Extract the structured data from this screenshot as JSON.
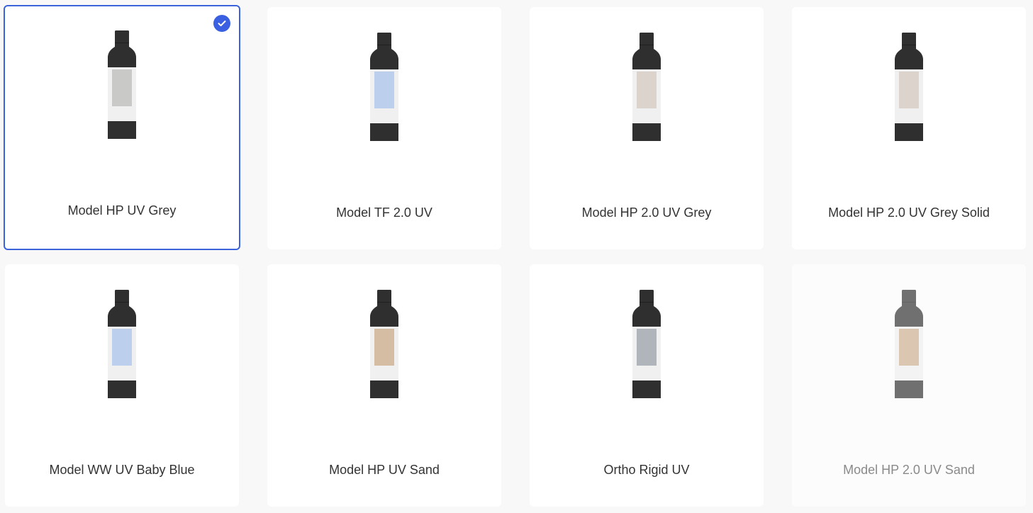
{
  "materials": [
    {
      "name": "Model HP UV Grey",
      "resin_color": "#c9c9c7",
      "selected": true,
      "disabled": false
    },
    {
      "name": "Model TF 2.0 UV",
      "resin_color": "#bccfec",
      "selected": false,
      "disabled": false
    },
    {
      "name": "Model HP 2.0 UV Grey",
      "resin_color": "#dcd3cc",
      "selected": false,
      "disabled": false
    },
    {
      "name": "Model HP 2.0 UV Grey Solid",
      "resin_color": "#dcd3cd",
      "selected": false,
      "disabled": false
    },
    {
      "name": "Model WW UV Baby Blue",
      "resin_color": "#bccfec",
      "selected": false,
      "disabled": false
    },
    {
      "name": "Model HP UV Sand",
      "resin_color": "#d5bda3",
      "selected": false,
      "disabled": false
    },
    {
      "name": "Ortho Rigid UV",
      "resin_color": "#afb5bb",
      "selected": false,
      "disabled": false
    },
    {
      "name": "Model HP 2.0 UV Sand",
      "resin_color": "#ccae8f",
      "selected": false,
      "disabled": true
    }
  ],
  "colors": {
    "accent": "#3a63dd",
    "bottle_dark": "#2f2f2f",
    "bottle_body": "#f0f0f0",
    "card_bg": "#ffffff",
    "page_bg": "#f8f8f8"
  },
  "icons": {
    "selected": "check-circle-icon",
    "item": "resin-bottle-icon"
  }
}
